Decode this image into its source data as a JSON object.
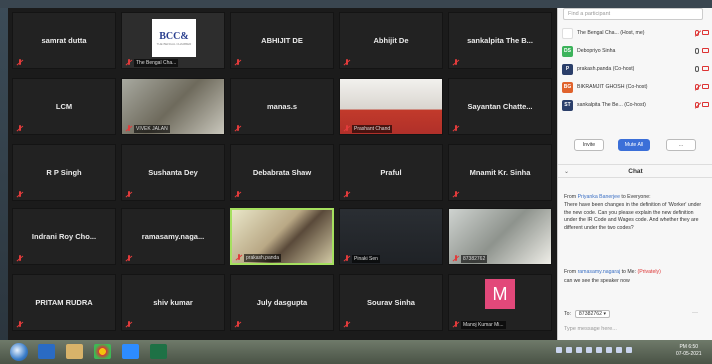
{
  "gallery": {
    "tiles": [
      {
        "name": "samrat dutta"
      },
      {
        "name": "",
        "caption": "The Bengal Cha..."
      },
      {
        "name": "ABHIJIT DE"
      },
      {
        "name": "Abhijit De"
      },
      {
        "name": "sankalpita The B..."
      },
      {
        "name": "LCM"
      },
      {
        "name": "",
        "caption": "VIVEK JALAN"
      },
      {
        "name": "manas.s"
      },
      {
        "name": "",
        "caption": "Prashant Chand"
      },
      {
        "name": "Sayantan Chatte..."
      },
      {
        "name": "R P Singh"
      },
      {
        "name": "Sushanta Dey"
      },
      {
        "name": "Debabrata Shaw"
      },
      {
        "name": "Praful"
      },
      {
        "name": "Mnamit Kr. Sinha"
      },
      {
        "name": "Indrani Roy Cho..."
      },
      {
        "name": "ramasamy.naga..."
      },
      {
        "name": "",
        "caption": "prakash.panda"
      },
      {
        "name": "",
        "caption": "Pinaki Sen"
      },
      {
        "name": "",
        "caption": "87382762"
      },
      {
        "name": "PRITAM RUDRA"
      },
      {
        "name": "shiv kumar"
      },
      {
        "name": "July dasgupta"
      },
      {
        "name": "Sourav Sinha"
      },
      {
        "name": "",
        "caption": "Manoj Kumar Mi...",
        "avatar_letter": "M"
      }
    ],
    "logo": {
      "text": "BCC&",
      "sub": "THE BENGAL CHAMBER"
    }
  },
  "participants": {
    "search_placeholder": "Find a participant",
    "items": [
      {
        "initials": "",
        "name": "The Bengal Cha... (Host, me)",
        "color": "#ffffff"
      },
      {
        "initials": "DS",
        "name": "Debopriyo Sinha",
        "color": "#3cb35b"
      },
      {
        "initials": "P",
        "name": "prakash.panda (Co-host)",
        "color": "#2b3f6a"
      },
      {
        "initials": "BG",
        "name": "BIKRAMJIT GHOSH (Co-host)",
        "color": "#e0622c"
      },
      {
        "initials": "ST",
        "name": "sankalpita The Be... (Co-host)",
        "color": "#2b3f6a"
      }
    ],
    "invite_label": "Invite",
    "mute_all_label": "Mute All",
    "more_label": "..."
  },
  "chat": {
    "title": "Chat",
    "message1_from_name": "Priyanka Banerjee",
    "message1_to": "to Everyone:",
    "message1_from_prefix": "From",
    "message1_text": "There have been changes in the definition of 'Worker' under the new code. Can you please explain the new definition under the IR Code and Wages code. And whether they are different under the two codes?",
    "message2_from_prefix": "From",
    "message2_from_name": "ramasamy.nagaraj",
    "message2_to": "to Me:",
    "message2_private": "(Privately)",
    "message2_text": "can we see the speaker now",
    "to_label": "To:",
    "to_value": "87382762 ▾",
    "input_placeholder": "Type message here..."
  },
  "taskbar": {
    "time": "PM 6:50",
    "date": "07-05-2021"
  }
}
